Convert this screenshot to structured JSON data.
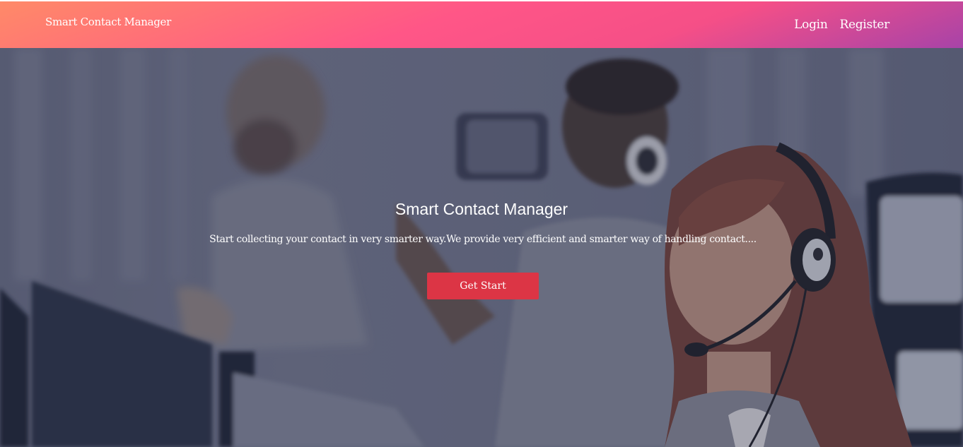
{
  "navbar": {
    "brand": "Smart Contact Manager",
    "links": [
      {
        "label": "Login"
      },
      {
        "label": "Register"
      }
    ]
  },
  "hero": {
    "title": "Smart Contact Manager",
    "subtitle": "Start collecting your contact in very smarter way.We provide very efficient and smarter way of handling contact....",
    "button_label": "Get Start"
  },
  "colors": {
    "navbar_gradient_start": "#ff8a68",
    "navbar_gradient_mid": "#ff5687",
    "navbar_gradient_end": "#a743a8",
    "button": "#dc3545",
    "text": "#ffffff"
  }
}
